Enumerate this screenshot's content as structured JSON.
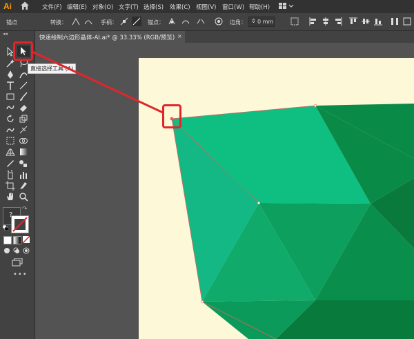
{
  "app": {
    "logo": "Ai"
  },
  "menu": {
    "items": [
      "文件(F)",
      "编辑(E)",
      "对象(O)",
      "文字(T)",
      "选择(S)",
      "效果(C)",
      "视图(V)",
      "窗口(W)",
      "帮助(H)"
    ]
  },
  "control_bar": {
    "mode_label": "锚点",
    "convert_label": "转换：",
    "handles_label": "手柄：",
    "anchor_label": "锚点：",
    "corner_label": "边角：",
    "corner_value": "0 mm"
  },
  "document": {
    "tab_title": "快速绘制六边形晶体-AI.ai* @ 33.33% (RGB/预览)",
    "tab_close": "×"
  },
  "tooltip": {
    "text": "直接选择工具 (A)"
  },
  "colors": {
    "accent_red": "#e0262c",
    "artboard": "#fdf8d8",
    "gem_light": "#10bf82",
    "gem_mid": "#0a9a5a",
    "gem_dark": "#087a3c"
  }
}
